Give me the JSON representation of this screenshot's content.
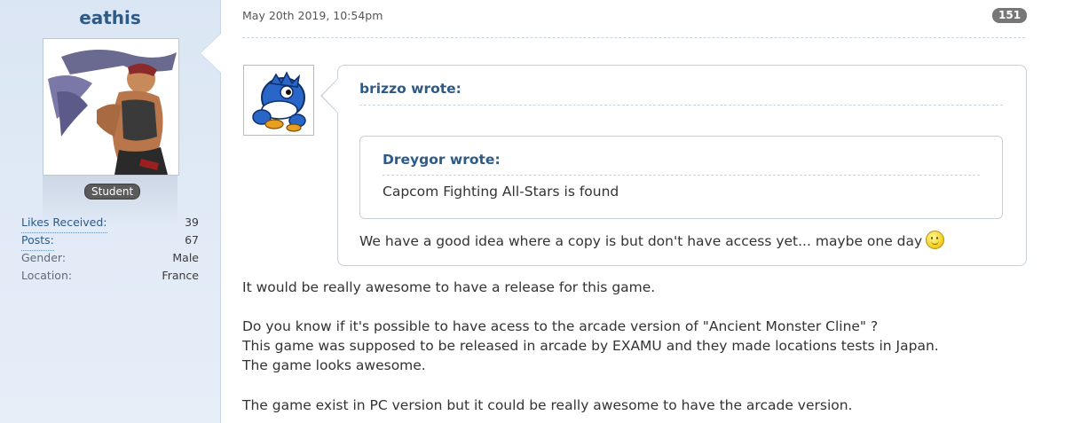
{
  "user": {
    "name": "eathis",
    "role": "Student",
    "stats": [
      {
        "label": "Likes Received:",
        "value": "39"
      },
      {
        "label": "Posts:",
        "value": "67"
      },
      {
        "label": "Gender:",
        "value": "Male"
      },
      {
        "label": "Location:",
        "value": "France"
      }
    ]
  },
  "post": {
    "date": "May 20th 2019, 10:54pm",
    "number": "151",
    "quote": {
      "author": "brizzo wrote:",
      "inner": {
        "author": "Dreygor wrote:",
        "text": "Capcom Fighting All-Stars is found"
      },
      "reply": "We have a good idea where a copy is but don't have access yet... maybe one day",
      "reply_icon": "smile-icon"
    },
    "paragraphs": [
      "It would be really awesome to have a release for this game.",
      "Do you know if it's possible to have acess to the arcade version of \"Ancient Monster Cline\" ?",
      "This game was supposed to be released in arcade by EXAMU and they made locations tests in Japan.",
      "The game looks awesome.",
      "The game exist in PC version but it could be really awesome to have the arcade version."
    ]
  },
  "colors": {
    "link": "#2e5a86",
    "panel_bg": "#dbe6f4",
    "badge_bg": "#5b5b5b"
  }
}
